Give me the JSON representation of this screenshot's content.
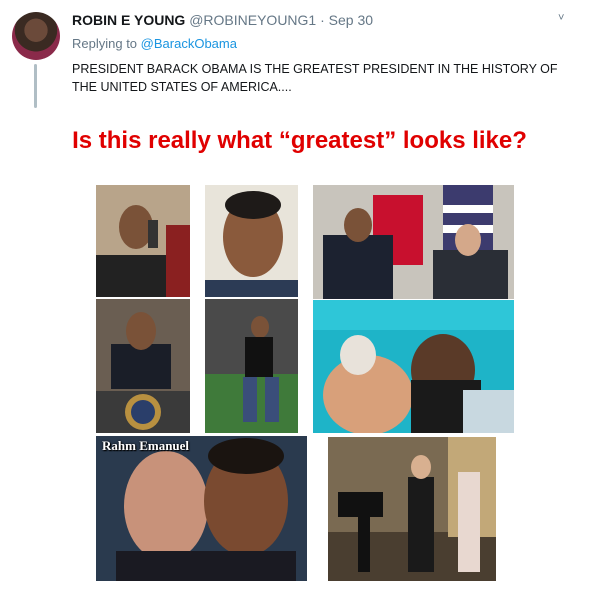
{
  "tweet": {
    "display_name": "ROBIN E YOUNG",
    "handle": "@ROBINEYOUNG1",
    "separator": "·",
    "date": "Sep 30",
    "chevron": "˅",
    "replying_prefix": "Replying to",
    "replying_to": "@BarackObama",
    "text": "PRESIDENT BARACK OBAMA IS THE GREATEST PRESIDENT IN THE HISTORY OF THE UNITED STATES OF AMERICA...."
  },
  "image": {
    "headline": "Is this really what “greatest” looks like?",
    "caption_rahm": "Rahm Emanuel"
  },
  "colors": {
    "headline": "#e00000",
    "link": "#1b95e0",
    "muted": "#657786",
    "thread_line": "#b0bec5"
  },
  "icons": {
    "caret": "chevron-down-icon"
  }
}
